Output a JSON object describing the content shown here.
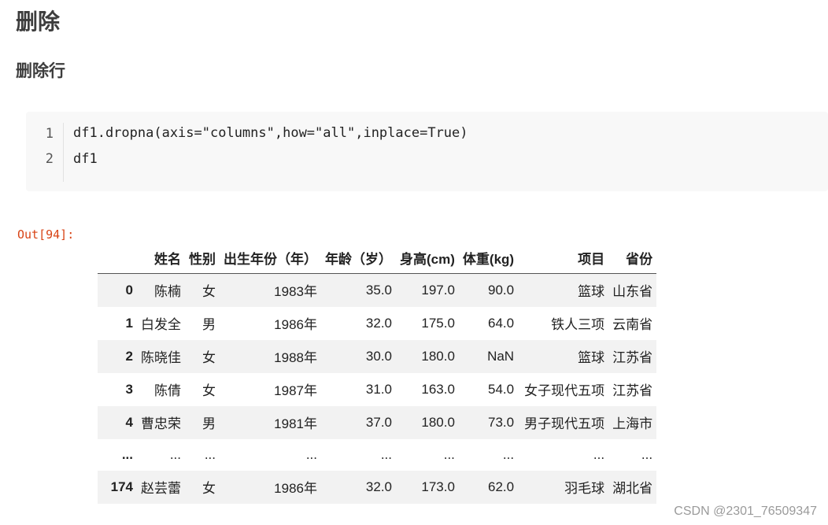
{
  "heading1": "删除",
  "heading2": "删除行",
  "code": {
    "lines": [
      {
        "no": "1",
        "text": "df1.dropna(axis=\"columns\",how=\"all\",inplace=True)"
      },
      {
        "no": "2",
        "text": "df1"
      }
    ]
  },
  "output_prompt": "Out[94]:",
  "table": {
    "columns": [
      "",
      "姓名",
      "性别",
      "出生年份（年）",
      "年龄（岁）",
      "身高(cm)",
      "体重(kg)",
      "项目",
      "省份"
    ],
    "rows": [
      [
        "0",
        "陈楠",
        "女",
        "1983年",
        "35.0",
        "197.0",
        "90.0",
        "篮球",
        "山东省"
      ],
      [
        "1",
        "白发全",
        "男",
        "1986年",
        "32.0",
        "175.0",
        "64.0",
        "铁人三项",
        "云南省"
      ],
      [
        "2",
        "陈晓佳",
        "女",
        "1988年",
        "30.0",
        "180.0",
        "NaN",
        "篮球",
        "江苏省"
      ],
      [
        "3",
        "陈倩",
        "女",
        "1987年",
        "31.0",
        "163.0",
        "54.0",
        "女子现代五项",
        "江苏省"
      ],
      [
        "4",
        "曹忠荣",
        "男",
        "1981年",
        "37.0",
        "180.0",
        "73.0",
        "男子现代五项",
        "上海市"
      ],
      [
        "...",
        "...",
        "...",
        "...",
        "...",
        "...",
        "...",
        "...",
        "..."
      ],
      [
        "174",
        "赵芸蕾",
        "女",
        "1986年",
        "32.0",
        "173.0",
        "62.0",
        "羽毛球",
        "湖北省"
      ]
    ]
  },
  "watermark": "CSDN @2301_76509347"
}
